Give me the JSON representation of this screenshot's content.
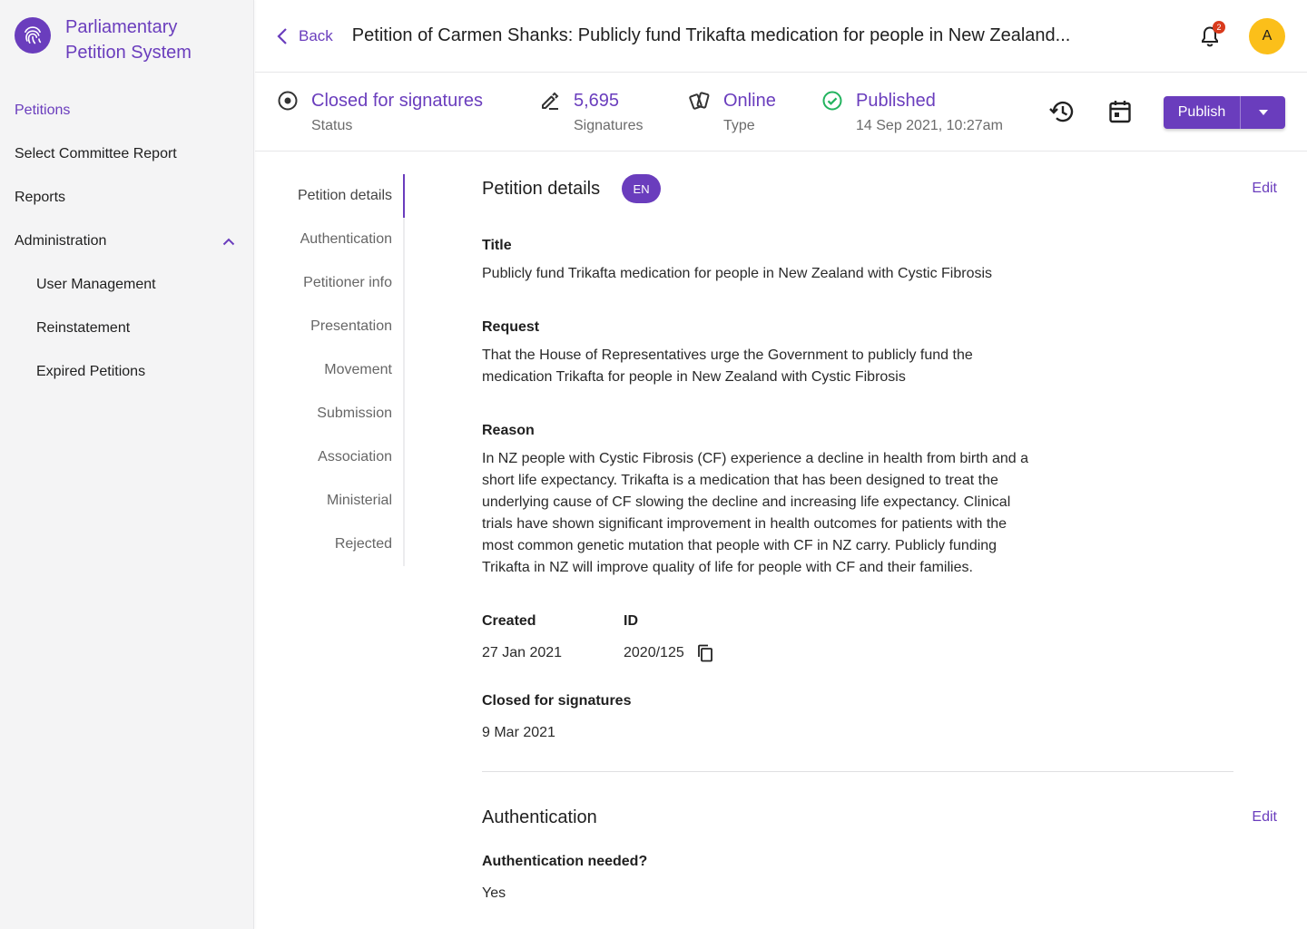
{
  "app": {
    "name_line1": "Parliamentary",
    "name_line2": "Petition System"
  },
  "sidebar": {
    "items": [
      {
        "label": "Petitions"
      },
      {
        "label": "Select Committee Report"
      },
      {
        "label": "Reports"
      },
      {
        "label": "Administration"
      },
      {
        "label": "User Management"
      },
      {
        "label": "Reinstatement"
      },
      {
        "label": "Expired Petitions"
      }
    ]
  },
  "header": {
    "back_label": "Back",
    "title": "Petition of Carmen Shanks: Publicly fund Trikafta medication for people in New Zealand...",
    "notification_count": "2",
    "avatar_initial": "A"
  },
  "status": {
    "status_value": "Closed for signatures",
    "status_label": "Status",
    "signatures_value": "5,695",
    "signatures_label": "Signatures",
    "type_value": "Online",
    "type_label": "Type",
    "published_value": "Published",
    "published_date": "14 Sep 2021, 10:27am",
    "publish_button": "Publish"
  },
  "section_nav": [
    {
      "label": "Petition details"
    },
    {
      "label": "Authentication"
    },
    {
      "label": "Petitioner info"
    },
    {
      "label": "Presentation"
    },
    {
      "label": "Movement"
    },
    {
      "label": "Submission"
    },
    {
      "label": "Association"
    },
    {
      "label": "Ministerial"
    },
    {
      "label": "Rejected"
    }
  ],
  "petition_details": {
    "heading": "Petition details",
    "language_badge": "EN",
    "edit_label": "Edit",
    "title_label": "Title",
    "title_value": "Publicly fund Trikafta medication for people in New Zealand with Cystic Fibrosis",
    "request_label": "Request",
    "request_value": "That the House of Representatives urge the Government to publicly fund the medication Trikafta for people in New Zealand with Cystic Fibrosis",
    "reason_label": "Reason",
    "reason_value": "In NZ people with Cystic Fibrosis (CF) experience a decline in health from birth and a short life expectancy. Trikafta is a medication that has been designed to treat the underlying cause of CF slowing the decline and increasing life expectancy. Clinical trials have shown significant improvement in health outcomes for patients with the most common genetic mutation that people with CF in NZ carry. Publicly funding Trikafta in NZ will improve quality of life for people with CF and their families.",
    "created_label": "Created",
    "created_value": "27 Jan 2021",
    "id_label": "ID",
    "id_value": "2020/125",
    "closed_label": "Closed for signatures",
    "closed_value": "9 Mar 2021"
  },
  "authentication": {
    "heading": "Authentication",
    "edit_label": "Edit",
    "needed_label": "Authentication needed?",
    "needed_value": "Yes"
  },
  "colors": {
    "accent": "#6a3dbd",
    "published_green": "#22b35e",
    "avatar": "#fbbf1a",
    "badge_red": "#d93a1c"
  },
  "icons": [
    "fingerprint-icon",
    "chevron-up-icon",
    "chevron-left-icon",
    "bell-icon",
    "radio-target-icon",
    "pen-signature-icon",
    "devices-icon",
    "check-circle-icon",
    "history-icon",
    "calendar-icon",
    "caret-down-icon",
    "copy-icon"
  ]
}
